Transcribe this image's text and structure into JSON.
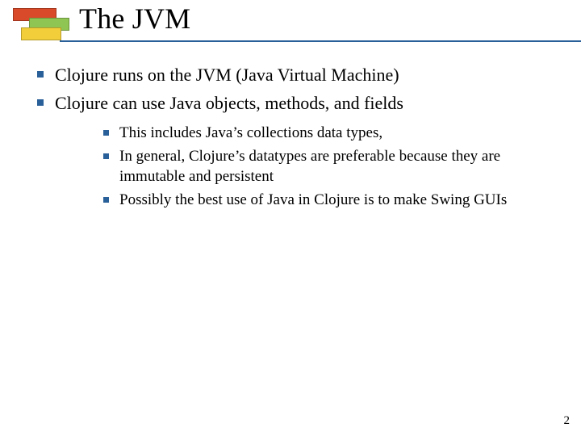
{
  "title": "The JVM",
  "bullets": {
    "b0": "Clojure runs on the JVM (Java Virtual Machine)",
    "b1": "Clojure can use Java objects, methods, and fields"
  },
  "sub": {
    "s0": "This includes Java’s collections data types,",
    "s1": "In general, Clojure’s datatypes are preferable because they are immutable and persistent",
    "s2": "Possibly the best use of Java in Clojure is to make Swing GUIs"
  },
  "page_number": "2"
}
